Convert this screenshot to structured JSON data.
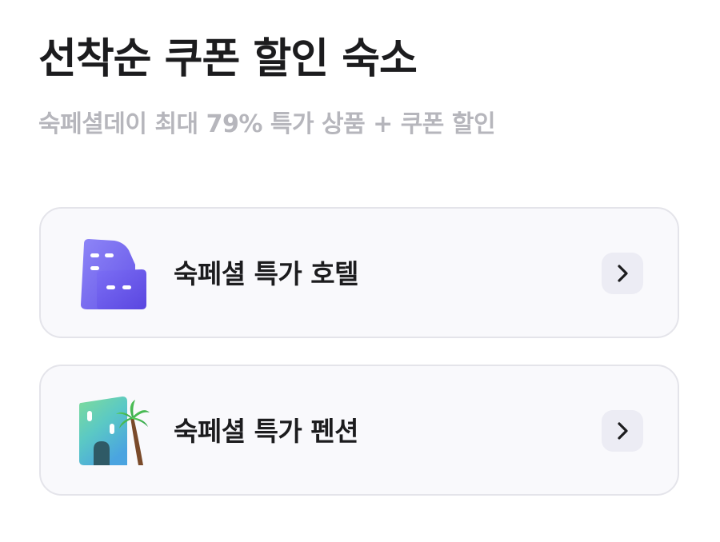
{
  "header": {
    "title": "선착순 쿠폰 할인 숙소",
    "subtitle": "숙페셜데이 최대 79% 특가 상품 + 쿠폰 할인"
  },
  "cards": [
    {
      "label": "숙페셜 특가 호텔",
      "icon": "hotel-building-icon",
      "action_icon": "chevron-right-icon"
    },
    {
      "label": "숙페셜 특가 펜션",
      "icon": "pension-palm-icon",
      "action_icon": "chevron-right-icon"
    }
  ],
  "colors": {
    "title": "#1c1c1e",
    "subtitle": "#b6b6bc",
    "card_background": "#f9f9fc",
    "card_border": "#e4e4ea",
    "button_background": "#ececf4",
    "hotel_icon_purple": "#6f5cf0",
    "pension_icon_teal": "#5ec8c8"
  }
}
